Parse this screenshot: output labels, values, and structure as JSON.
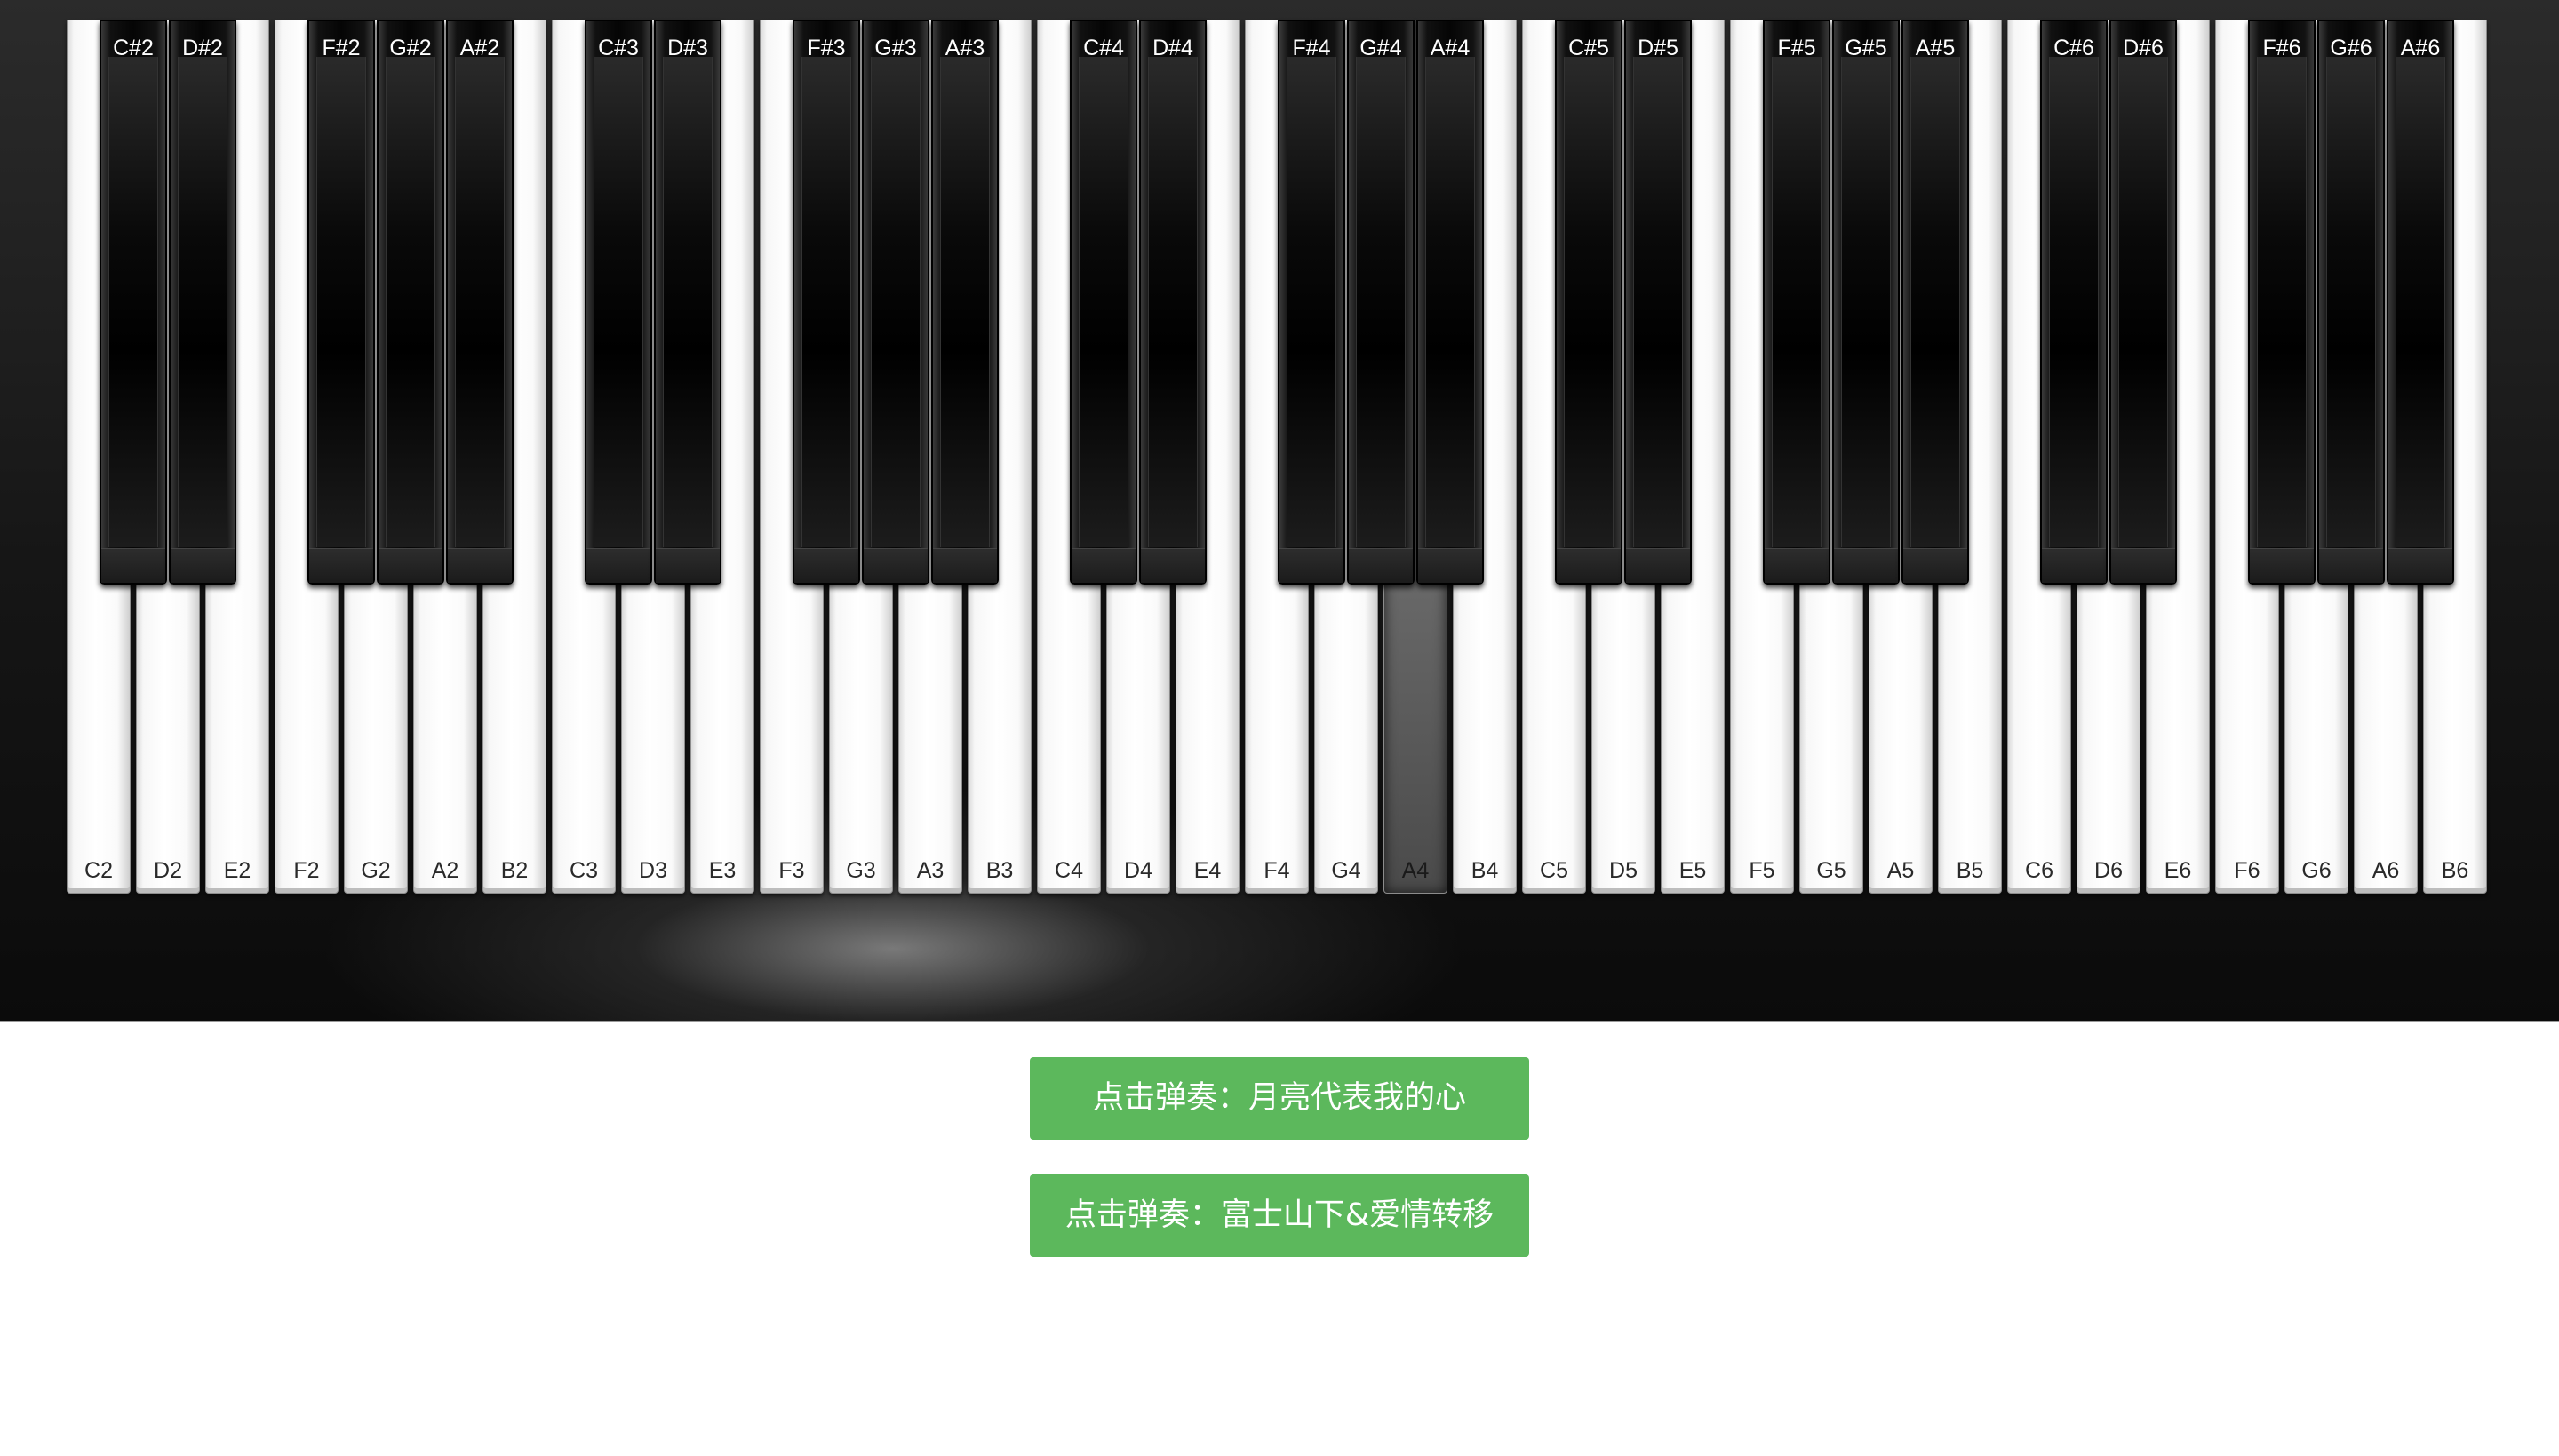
{
  "piano": {
    "white_keys": [
      {
        "label": "C2"
      },
      {
        "label": "D2"
      },
      {
        "label": "E2"
      },
      {
        "label": "F2"
      },
      {
        "label": "G2"
      },
      {
        "label": "A2"
      },
      {
        "label": "B2"
      },
      {
        "label": "C3"
      },
      {
        "label": "D3"
      },
      {
        "label": "E3"
      },
      {
        "label": "F3"
      },
      {
        "label": "G3"
      },
      {
        "label": "A3"
      },
      {
        "label": "B3"
      },
      {
        "label": "C4"
      },
      {
        "label": "D4"
      },
      {
        "label": "E4"
      },
      {
        "label": "F4"
      },
      {
        "label": "G4"
      },
      {
        "label": "A4",
        "pressed": true
      },
      {
        "label": "B4"
      },
      {
        "label": "C5"
      },
      {
        "label": "D5"
      },
      {
        "label": "E5"
      },
      {
        "label": "F5"
      },
      {
        "label": "G5"
      },
      {
        "label": "A5"
      },
      {
        "label": "B5"
      },
      {
        "label": "C6"
      },
      {
        "label": "D6"
      },
      {
        "label": "E6"
      },
      {
        "label": "F6"
      },
      {
        "label": "G6"
      },
      {
        "label": "A6"
      },
      {
        "label": "B6"
      }
    ],
    "black_keys": [
      {
        "label": "C#2"
      },
      {
        "label": "D#2"
      },
      {
        "label": "F#2"
      },
      {
        "label": "G#2"
      },
      {
        "label": "A#2"
      },
      {
        "label": "C#3"
      },
      {
        "label": "D#3"
      },
      {
        "label": "F#3"
      },
      {
        "label": "G#3"
      },
      {
        "label": "A#3"
      },
      {
        "label": "C#4"
      },
      {
        "label": "D#4"
      },
      {
        "label": "F#4"
      },
      {
        "label": "G#4"
      },
      {
        "label": "A#4"
      },
      {
        "label": "C#5"
      },
      {
        "label": "D#5"
      },
      {
        "label": "F#5"
      },
      {
        "label": "G#5"
      },
      {
        "label": "A#5"
      },
      {
        "label": "C#6"
      },
      {
        "label": "D#6"
      },
      {
        "label": "F#6"
      },
      {
        "label": "G#6"
      },
      {
        "label": "A#6"
      }
    ]
  },
  "songs": {
    "play_moon_label": "点击弹奏：月亮代表我的心",
    "play_fuji_label": "点击弹奏：富士山下&爱情转移"
  },
  "colors": {
    "button_green": "#5cb85c",
    "piano_body": "#1a1a1a",
    "pressed_key": "#6c6c6c"
  }
}
